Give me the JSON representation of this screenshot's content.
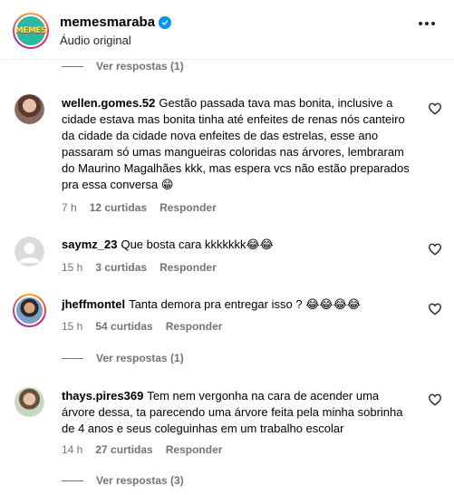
{
  "header": {
    "username": "memesmaraba",
    "subtitle": "Áudio original",
    "avatar_text": "MEMES"
  },
  "top_replies": "Ver respostas (1)",
  "comments": [
    {
      "user": "wellen.gomes.52",
      "text": "Gestão passada tava mas bonita, inclusive a cidade estava mas bonita tinha até enfeites de renas nós canteiro da cidade da cidade nova enfeites de das estrelas, esse ano passaram só umas mangueiras coloridas nas árvores, lembraram do Maurino Magalhães kkk, mas espera vcs não estão preparados pra essa conversa",
      "emojis": "😁",
      "time": "7 h",
      "likes": "12 curtidas",
      "reply": "Responder"
    },
    {
      "user": "saymz_23",
      "text": "Que bosta cara kkkkkkk",
      "emojis": "😂😂",
      "time": "15 h",
      "likes": "3 curtidas",
      "reply": "Responder"
    },
    {
      "user": "jheffmontel",
      "text": "Tanta demora pra entregar isso ?",
      "emojis": "😂😂😂😂",
      "time": "15 h",
      "likes": "54 curtidas",
      "reply": "Responder",
      "replies": "Ver respostas (1)"
    },
    {
      "user": "thays.pires369",
      "text": "Tem nem vergonha na cara de acender uma árvore dessa, ta parecendo uma árvore feita pela minha sobrinha de 4 anos e seus coleguinhas em um trabalho escolar",
      "emojis": "",
      "time": "14 h",
      "likes": "27 curtidas",
      "reply": "Responder",
      "replies": "Ver respostas (3)"
    }
  ]
}
